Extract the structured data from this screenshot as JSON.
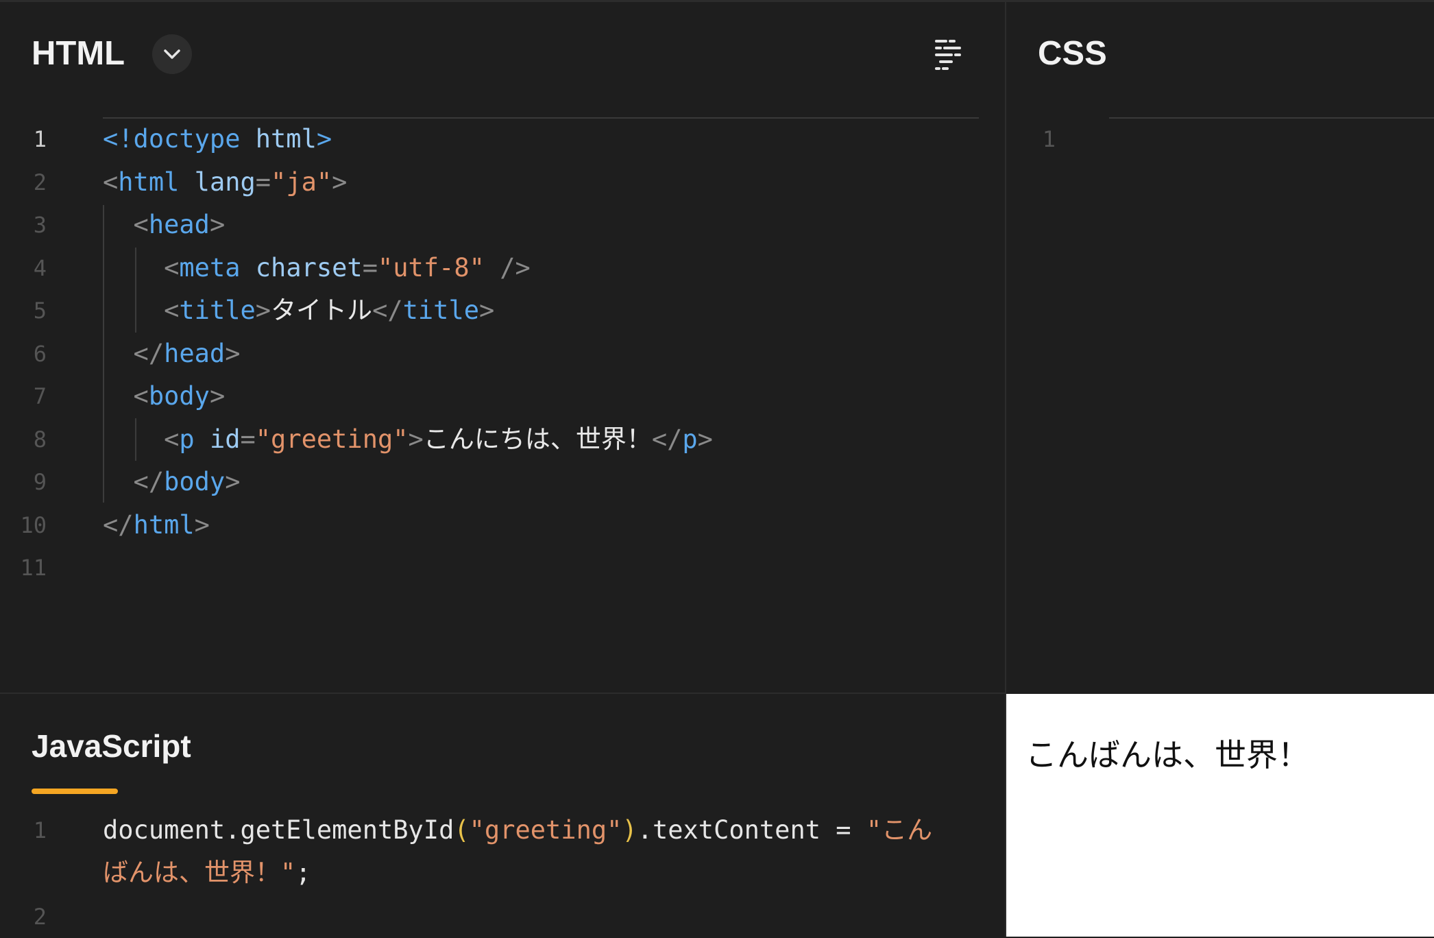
{
  "html_panel": {
    "title": "HTML",
    "line_numbers": [
      "1",
      "2",
      "3",
      "4",
      "5",
      "6",
      "7",
      "8",
      "9",
      "10",
      "11"
    ],
    "lines": [
      [
        {
          "t": "<!doctype",
          "c": "tag"
        },
        {
          "t": " html",
          "c": "attr"
        },
        {
          "t": ">",
          "c": "tag"
        }
      ],
      [
        {
          "t": "<",
          "c": "punc"
        },
        {
          "t": "html",
          "c": "tag"
        },
        {
          "t": " lang",
          "c": "attr"
        },
        {
          "t": "=",
          "c": "punc"
        },
        {
          "t": "\"ja\"",
          "c": "str"
        },
        {
          "t": ">",
          "c": "punc"
        }
      ],
      [
        {
          "t": "  <",
          "c": "punc"
        },
        {
          "t": "head",
          "c": "tag"
        },
        {
          "t": ">",
          "c": "punc"
        }
      ],
      [
        {
          "t": "    <",
          "c": "punc"
        },
        {
          "t": "meta",
          "c": "tag"
        },
        {
          "t": " charset",
          "c": "attr"
        },
        {
          "t": "=",
          "c": "punc"
        },
        {
          "t": "\"utf-8\"",
          "c": "str"
        },
        {
          "t": " />",
          "c": "punc"
        }
      ],
      [
        {
          "t": "    <",
          "c": "punc"
        },
        {
          "t": "title",
          "c": "tag"
        },
        {
          "t": ">",
          "c": "punc"
        },
        {
          "t": "タイトル",
          "c": "text"
        },
        {
          "t": "</",
          "c": "punc"
        },
        {
          "t": "title",
          "c": "tag"
        },
        {
          "t": ">",
          "c": "punc"
        }
      ],
      [
        {
          "t": "  </",
          "c": "punc"
        },
        {
          "t": "head",
          "c": "tag"
        },
        {
          "t": ">",
          "c": "punc"
        }
      ],
      [
        {
          "t": "  <",
          "c": "punc"
        },
        {
          "t": "body",
          "c": "tag"
        },
        {
          "t": ">",
          "c": "punc"
        }
      ],
      [
        {
          "t": "    <",
          "c": "punc"
        },
        {
          "t": "p",
          "c": "tag"
        },
        {
          "t": " id",
          "c": "attr"
        },
        {
          "t": "=",
          "c": "punc"
        },
        {
          "t": "\"greeting\"",
          "c": "str"
        },
        {
          "t": ">",
          "c": "punc"
        },
        {
          "t": "こんにちは、世界！",
          "c": "text"
        },
        {
          "t": "</",
          "c": "punc"
        },
        {
          "t": "p",
          "c": "tag"
        },
        {
          "t": ">",
          "c": "punc"
        }
      ],
      [
        {
          "t": "  </",
          "c": "punc"
        },
        {
          "t": "body",
          "c": "tag"
        },
        {
          "t": ">",
          "c": "punc"
        }
      ],
      [
        {
          "t": "</",
          "c": "punc"
        },
        {
          "t": "html",
          "c": "tag"
        },
        {
          "t": ">",
          "c": "punc"
        }
      ],
      []
    ]
  },
  "css_panel": {
    "title": "CSS",
    "line_numbers": [
      "1"
    ]
  },
  "js_panel": {
    "title": "JavaScript",
    "line_numbers": [
      "1",
      "2"
    ],
    "lines": [
      [
        {
          "t": "document.getElementById",
          "c": "plain"
        },
        {
          "t": "(",
          "c": "paren"
        },
        {
          "t": "\"greeting\"",
          "c": "str"
        },
        {
          "t": ")",
          "c": "paren"
        },
        {
          "t": ".textContent = ",
          "c": "plain"
        },
        {
          "t": "\"こん",
          "c": "str"
        }
      ],
      [
        {
          "t": "ばんは、世界！\"",
          "c": "str"
        },
        {
          "t": ";",
          "c": "plain"
        }
      ]
    ]
  },
  "preview": {
    "text": "こんばんは、世界！"
  },
  "colors": {
    "accent": "#f5a623",
    "background": "#1e1e1e"
  },
  "icons": {
    "dropdown": "chevron-down-icon",
    "format": "format-code-icon"
  }
}
